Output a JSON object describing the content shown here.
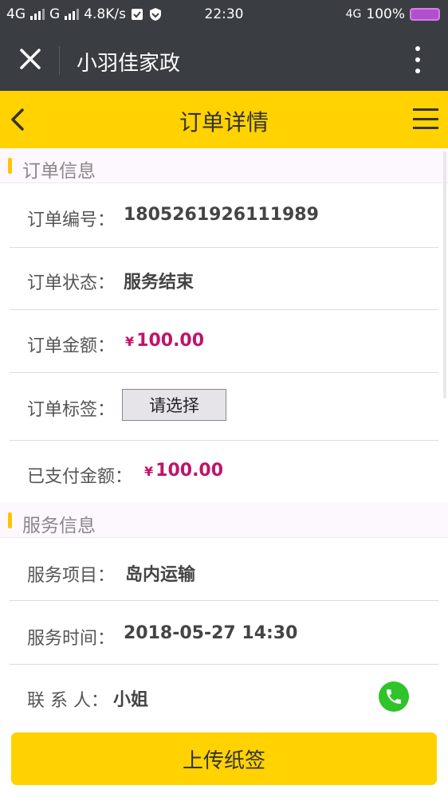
{
  "status_bar": {
    "net1": "4G",
    "net2": "G",
    "speed": "4.8K/s",
    "time": "22:30",
    "net3": "4G",
    "battery": "100%"
  },
  "wechat_bar": {
    "title": "小羽佳家政",
    "icons": [
      "close-icon",
      "more-vertical-icon"
    ]
  },
  "page_header": {
    "title": "订单详情",
    "icons": [
      "back-chevron-icon",
      "menu-icon"
    ]
  },
  "order_section": {
    "title": "订单信息",
    "rows": [
      {
        "label": "订单编号：",
        "value": "1805261926111989"
      },
      {
        "label": "订单状态：",
        "value": "服务结束"
      },
      {
        "label": "订单金额：",
        "currency": "¥",
        "value": "100.00"
      },
      {
        "label": "订单标签：",
        "select_value": "请选择"
      },
      {
        "label": "已支付金额：",
        "currency": "¥",
        "value": "100.00"
      }
    ]
  },
  "service_section": {
    "title": "服务信息",
    "rows": [
      {
        "label": "服务项目：",
        "value": "岛内运输"
      },
      {
        "label": "服务时间：",
        "value": "2018-05-27 14:30"
      },
      {
        "label": "联 系 人：",
        "value": "小姐"
      }
    ]
  },
  "bottom": {
    "upload_label": "上传纸签"
  },
  "colors": {
    "accent": "#ffd200",
    "dark_bar": "#3a3d42",
    "money": "#c0136a",
    "phone": "#2fc42a"
  }
}
